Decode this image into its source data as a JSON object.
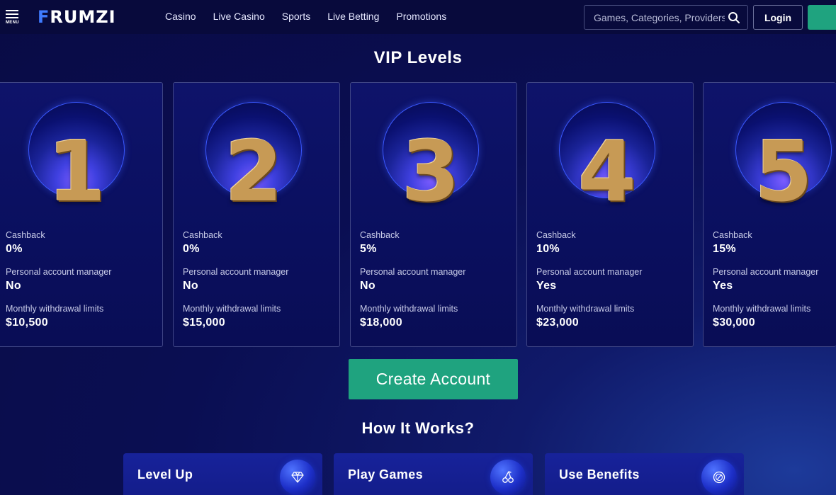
{
  "header": {
    "menu_label": "MENU",
    "logo_first": "F",
    "logo_rest": "RUMZI",
    "nav": [
      "Casino",
      "Live Casino",
      "Sports",
      "Live Betting",
      "Promotions"
    ],
    "search_placeholder": "Games, Categories, Providers",
    "login_label": "Login"
  },
  "vip": {
    "title": "VIP Levels",
    "levels": [
      {
        "level": "1",
        "cashback_label": "Cashback",
        "cashback": "0%",
        "manager_label": "Personal account manager",
        "manager": "No",
        "limit_label": "Monthly withdrawal limits",
        "limit": "$10,500"
      },
      {
        "level": "2",
        "cashback_label": "Cashback",
        "cashback": "0%",
        "manager_label": "Personal account manager",
        "manager": "No",
        "limit_label": "Monthly withdrawal limits",
        "limit": "$15,000"
      },
      {
        "level": "3",
        "cashback_label": "Cashback",
        "cashback": "5%",
        "manager_label": "Personal account manager",
        "manager": "No",
        "limit_label": "Monthly withdrawal limits",
        "limit": "$18,000"
      },
      {
        "level": "4",
        "cashback_label": "Cashback",
        "cashback": "10%",
        "manager_label": "Personal account manager",
        "manager": "Yes",
        "limit_label": "Monthly withdrawal limits",
        "limit": "$23,000"
      },
      {
        "level": "5",
        "cashback_label": "Cashback",
        "cashback": "15%",
        "manager_label": "Personal account manager",
        "manager": "Yes",
        "limit_label": "Monthly withdrawal limits",
        "limit": "$30,000"
      }
    ],
    "create_button": "Create Account"
  },
  "how": {
    "title": "How It Works?",
    "cards": [
      {
        "label": "Level Up",
        "icon": "diamond-icon"
      },
      {
        "label": "Play Games",
        "icon": "cherries-icon"
      },
      {
        "label": "Use Benefits",
        "icon": "coin-icon"
      }
    ]
  },
  "colors": {
    "background": "#0a0e52",
    "header": "#080a3c",
    "accent_green": "#1fa37f",
    "logo_blue": "#3f7bff",
    "gold": "#c79a55"
  }
}
